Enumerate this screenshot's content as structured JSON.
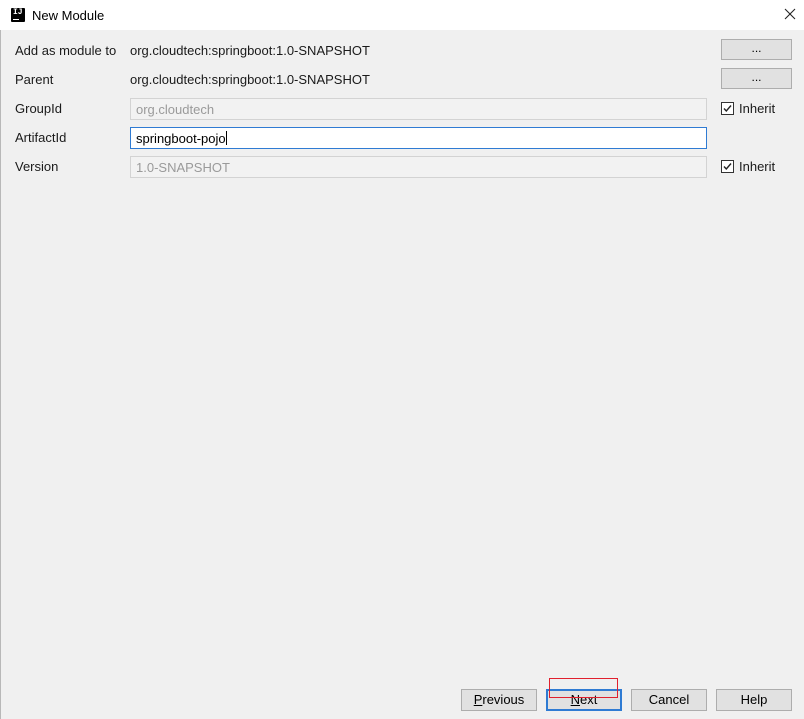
{
  "window": {
    "title": "New Module",
    "app_icon_text": "IJ"
  },
  "form": {
    "module_to_label": "Add as module to",
    "module_to_value": "org.cloudtech:springboot:1.0-SNAPSHOT",
    "module_to_browse": "...",
    "parent_label": "Parent",
    "parent_value": "org.cloudtech:springboot:1.0-SNAPSHOT",
    "parent_browse": "...",
    "groupid_label": "GroupId",
    "groupid_value": "org.cloudtech",
    "groupid_inherit_label": "Inherit",
    "groupid_inherit_checked": true,
    "artifactid_label": "ArtifactId",
    "artifactid_value": "springboot-pojo",
    "version_label": "Version",
    "version_value": "1.0-SNAPSHOT",
    "version_inherit_label": "Inherit",
    "version_inherit_checked": true
  },
  "buttons": {
    "previous_mnemonic": "P",
    "previous_rest": "revious",
    "next_mnemonic": "N",
    "next_rest": "ext",
    "cancel": "Cancel",
    "help": "Help"
  },
  "colors": {
    "focus": "#2f7bd3",
    "highlight_box": "#e0202e",
    "background": "#f0f0f0"
  }
}
